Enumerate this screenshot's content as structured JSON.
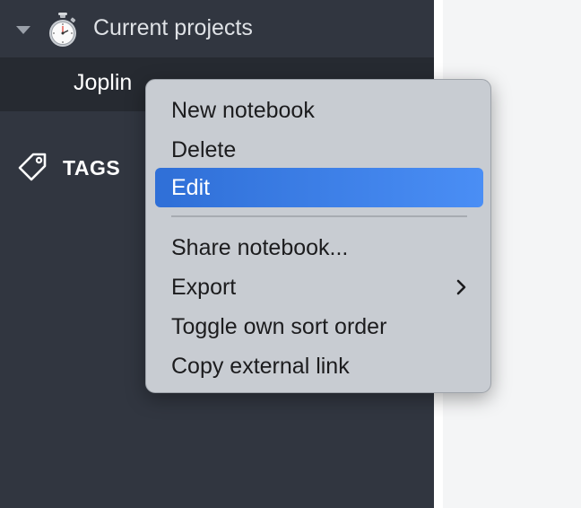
{
  "sidebar": {
    "folder": {
      "label": "Current projects",
      "icon": "stopwatch-icon",
      "expanded": true
    },
    "notebook": {
      "label": "Joplin"
    },
    "tags": {
      "label": "TAGS",
      "icon": "tag-icon"
    }
  },
  "context_menu": {
    "items": [
      {
        "label": "New notebook"
      },
      {
        "label": "Delete"
      },
      {
        "label": "Edit",
        "selected": true
      },
      {
        "label": "Share notebook..."
      },
      {
        "label": "Export",
        "submenu": true
      },
      {
        "label": "Toggle own sort order"
      },
      {
        "label": "Copy external link"
      }
    ]
  },
  "colors": {
    "sidebar_bg": "#313640",
    "selected_row_bg": "#262a31",
    "menu_bg": "#c8ccd2",
    "menu_highlight": "#3b7ee6"
  }
}
